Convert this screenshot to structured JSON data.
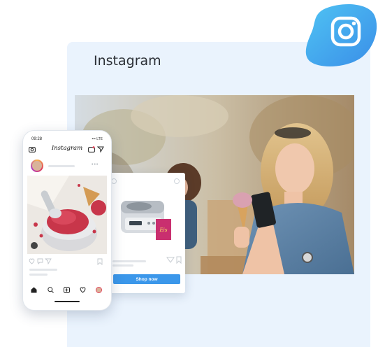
{
  "panel": {
    "title": "Instagram"
  },
  "icons": {
    "brand": "instagram-icon",
    "camera": "camera-icon",
    "igtv": "igtv-icon",
    "direct": "direct-message-icon",
    "home": "home-icon",
    "search": "search-icon",
    "add": "add-post-icon",
    "activity": "heart-icon",
    "bookmark": "bookmark-icon"
  },
  "colors": {
    "brand_gradient_start": "#43b7f0",
    "brand_gradient_end": "#3a8ee8",
    "panel_bg": "#eaf3fd",
    "shop_button": "#3b97ea"
  },
  "phone": {
    "time": "09:28",
    "signal": "••• LTE",
    "app_name": "Instagram"
  },
  "ad": {
    "cta": "Shop now",
    "book_title": "Eis"
  }
}
